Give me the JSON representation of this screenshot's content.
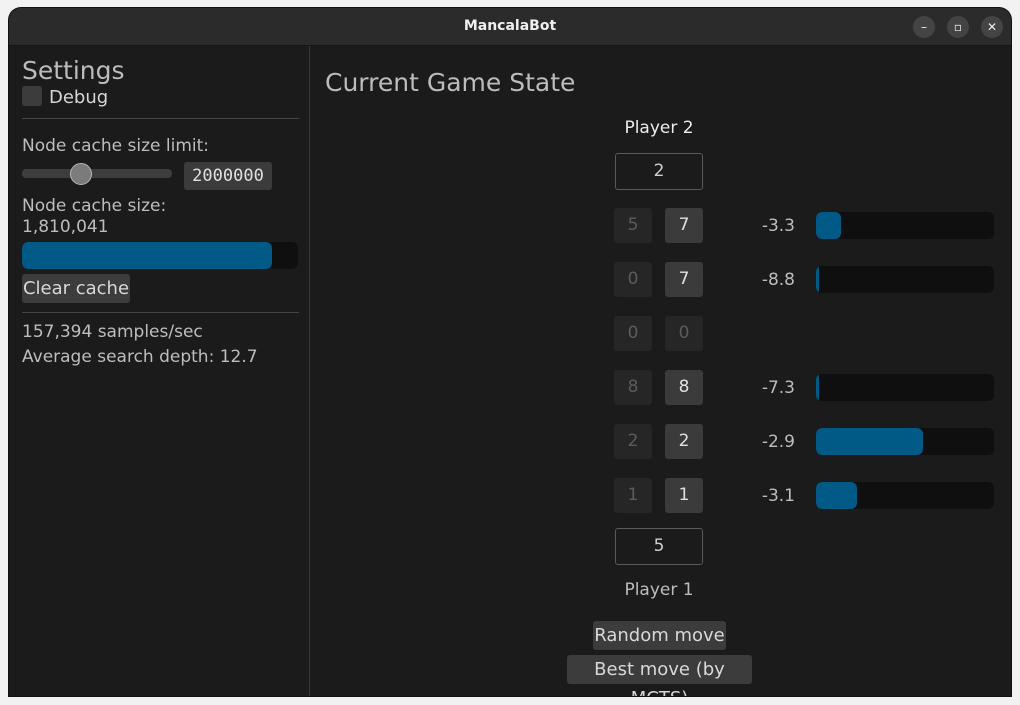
{
  "window": {
    "title": "MancalaBot"
  },
  "settings": {
    "title": "Settings",
    "debug_label": "Debug",
    "debug_checked": false,
    "cache_limit_label": "Node cache size limit:",
    "cache_limit_value": "2000000",
    "cache_size_label": "Node cache size:",
    "cache_size_value": "1,810,041",
    "cache_fill_fraction": 0.905,
    "clear_cache_label": "Clear cache",
    "samples_text": "157,394 samples/sec",
    "depth_text": "Average search depth: 12.7"
  },
  "game": {
    "title": "Current Game State",
    "player2_label": "Player 2",
    "player1_label": "Player 1",
    "store_p2": "2",
    "store_p1": "5",
    "rows": [
      {
        "p2": "5",
        "p1": "7",
        "value": "-3.3",
        "fill": 0.14
      },
      {
        "p2": "0",
        "p1": "7",
        "value": "-8.8",
        "fill": 0.01
      },
      {
        "p2": "0",
        "p1": "0",
        "value": "",
        "fill": null
      },
      {
        "p2": "8",
        "p1": "8",
        "value": "-7.3",
        "fill": 0.015
      },
      {
        "p2": "2",
        "p1": "2",
        "value": "-2.9",
        "fill": 0.6
      },
      {
        "p2": "1",
        "p1": "1",
        "value": "-3.1",
        "fill": 0.23
      }
    ],
    "random_move_label": "Random move",
    "best_move_label": "Best move (by MCTS)"
  },
  "colors": {
    "accent": "#005a85",
    "window_bg": "#1b1b1b",
    "titlebar_bg": "#2b2b2b"
  }
}
